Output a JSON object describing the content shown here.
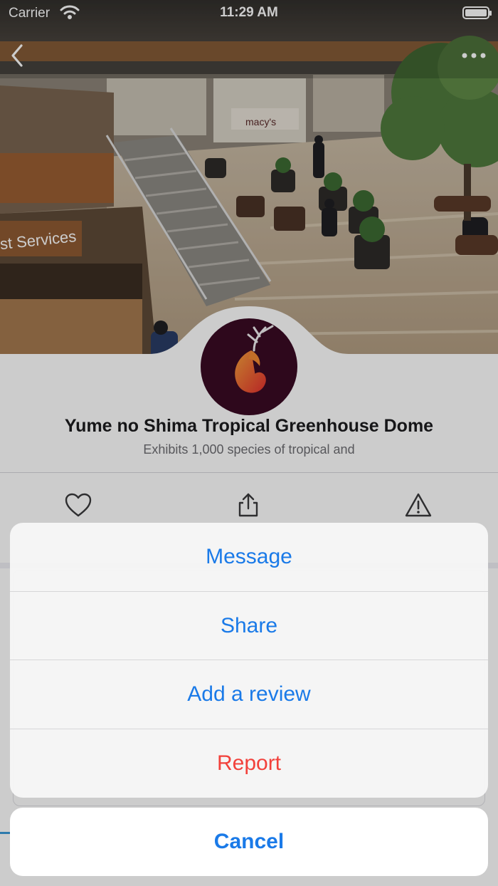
{
  "status_bar": {
    "carrier": "Carrier",
    "time": "11:29 AM",
    "battery_level": 1.0,
    "wifi_icon": "wifi-icon",
    "battery_icon": "battery-icon"
  },
  "nav": {
    "back_icon": "chevron-left-icon",
    "more_icon": "ellipsis-icon"
  },
  "hero": {
    "storefront_sign": "st Services",
    "store_sign": "macy's"
  },
  "place": {
    "title": "Yume no Shima Tropical Greenhouse Dome",
    "subtitle": "Exhibits 1,000 species of tropical and",
    "avatar_icon": "deer-logo-icon",
    "avatar_bg": "#3a0a24"
  },
  "actions": [
    {
      "name": "favorite",
      "icon": "heart-icon"
    },
    {
      "name": "share",
      "icon": "share-icon"
    },
    {
      "name": "report",
      "icon": "warning-icon"
    }
  ],
  "action_sheet": {
    "items": [
      {
        "label": "Message",
        "style": "default"
      },
      {
        "label": "Share",
        "style": "default"
      },
      {
        "label": "Add a review",
        "style": "default"
      },
      {
        "label": "Report",
        "style": "destructive"
      }
    ],
    "cancel_label": "Cancel"
  },
  "colors": {
    "accent": "#1a7ae8",
    "destructive": "#f2413b",
    "title": "#1c1c1e",
    "subtitle": "#6d6d72"
  }
}
